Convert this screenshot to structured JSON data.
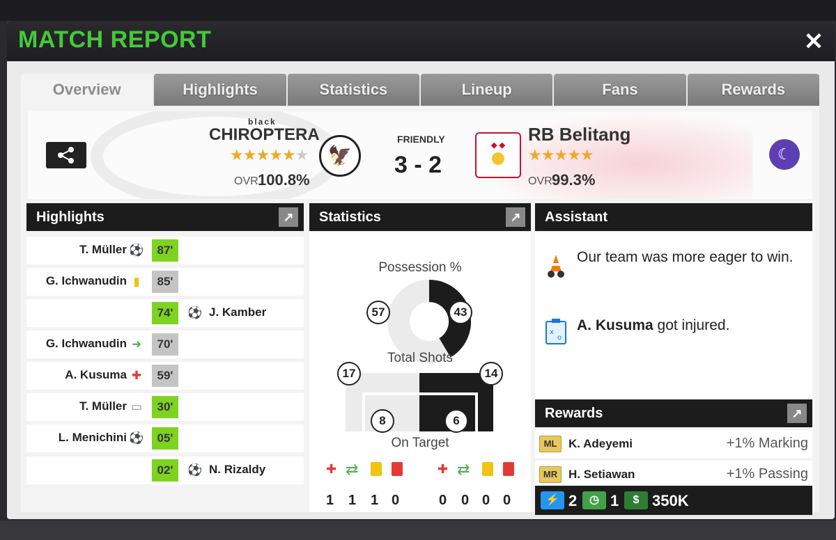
{
  "modal": {
    "title": "MATCH REPORT",
    "close_label": "✕"
  },
  "tabs": [
    {
      "label": "Overview",
      "active": true
    },
    {
      "label": "Highlights"
    },
    {
      "label": "Statistics"
    },
    {
      "label": "Lineup"
    },
    {
      "label": "Fans"
    },
    {
      "label": "Rewards"
    }
  ],
  "match": {
    "home": {
      "name_sub": "black",
      "name": "CHIROPTERA",
      "stars_filled": "★★★★★",
      "stars_empty": "★",
      "ovr_label": "OVR",
      "ovr": "100.8%"
    },
    "away": {
      "name": "RB Belitang",
      "stars_filled": "★★★★★",
      "ovr_label": "OVR",
      "ovr": "99.3%"
    },
    "type": "FRIENDLY",
    "score": "3 - 2"
  },
  "panels": {
    "highlights_title": "Highlights",
    "statistics_title": "Statistics",
    "assistant_title": "Assistant",
    "rewards_title": "Rewards",
    "expand_icon": "↗"
  },
  "highlights": [
    {
      "player_left": "T. Müller",
      "icon_left": "⚽",
      "minute": "87'",
      "green": true,
      "player_right": "",
      "icon_right": ""
    },
    {
      "player_left": "G. Ichwanudin",
      "icon_left": "▮",
      "minute": "85'",
      "green": false,
      "player_right": "",
      "icon_right": ""
    },
    {
      "player_left": "",
      "icon_left": "",
      "minute": "74'",
      "green": true,
      "player_right": "J. Kamber",
      "icon_right": "⚽"
    },
    {
      "player_left": "G. Ichwanudin",
      "icon_left": "➜",
      "minute": "70'",
      "green": false,
      "player_right": "",
      "icon_right": ""
    },
    {
      "player_left": "A. Kusuma",
      "icon_left": "✚",
      "minute": "59'",
      "green": false,
      "player_right": "",
      "icon_right": ""
    },
    {
      "player_left": "T. Müller",
      "icon_left": "▭",
      "minute": "30'",
      "green": true,
      "player_right": "",
      "icon_right": ""
    },
    {
      "player_left": "L. Menichini",
      "icon_left": "⚽",
      "minute": "05'",
      "green": true,
      "player_right": "",
      "icon_right": ""
    },
    {
      "player_left": "",
      "icon_left": "",
      "minute": "02'",
      "green": true,
      "player_right": "N. Rizaldy",
      "icon_right": "⚽"
    }
  ],
  "statistics": {
    "possession_label": "Possession %",
    "possession_home": "57",
    "possession_away": "43",
    "shots_label": "Total Shots",
    "shots_home": "17",
    "shots_away": "14",
    "on_target_label": "On Target",
    "on_target_home": "8",
    "on_target_away": "6",
    "home_counts": [
      "1",
      "1",
      "1",
      "0"
    ],
    "away_counts": [
      "0",
      "0",
      "0",
      "0"
    ]
  },
  "assistant": {
    "msg1": "Our team was more eager to win.",
    "msg2_name": "A. Kusuma",
    "msg2_rest": " got injured."
  },
  "rewards": {
    "rows": [
      {
        "position": "ML",
        "name": "K. Adeyemi",
        "value": "+1% Marking"
      },
      {
        "position": "MR",
        "name": "H. Setiawan",
        "value": "+1% Passing"
      }
    ],
    "energy": "2",
    "training": "1",
    "money": "350K"
  },
  "colors": {
    "title_green": "#44c93a",
    "minute_green": "#7ed321",
    "minute_grey": "#c4c4c4",
    "assist_purple": "#5e3fb3",
    "yellow_card": "#f1c40f",
    "red_card": "#e53935"
  }
}
